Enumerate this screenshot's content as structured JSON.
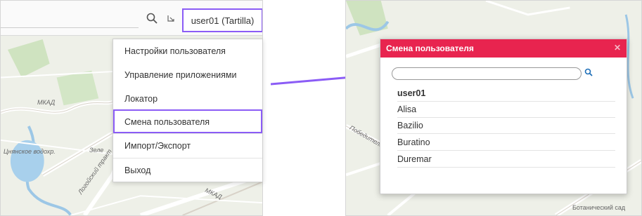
{
  "toolbar": {
    "user_label": "user01 (Tartilla)",
    "search_icon": "search-icon",
    "fullscreen_icon": "fullscreen-icon"
  },
  "menu": {
    "items": [
      {
        "label": "Настройки пользователя"
      },
      {
        "label": "Управление приложениями"
      },
      {
        "label": "Локатор"
      },
      {
        "label": "Смена пользователя"
      },
      {
        "label": "Импорт/Экспорт"
      },
      {
        "label": "Выход"
      }
    ]
  },
  "map_left": {
    "labels": [
      "МКАД",
      "Цнянское водохр.",
      "Зеле",
      "Логойский тракт",
      "МКАД"
    ]
  },
  "map_right": {
    "labels": [
      "Победителей",
      "Ботанический сад"
    ]
  },
  "dialog": {
    "title": "Смена пользователя",
    "close_icon": "close-icon",
    "search_placeholder": "",
    "users": [
      "user01",
      "Alisa",
      "Bazilio",
      "Buratino",
      "Duremar"
    ]
  },
  "colors": {
    "highlight": "#8b5cf6",
    "dialog_header": "#e8244f",
    "search_icon_color": "#1e6fb8"
  }
}
